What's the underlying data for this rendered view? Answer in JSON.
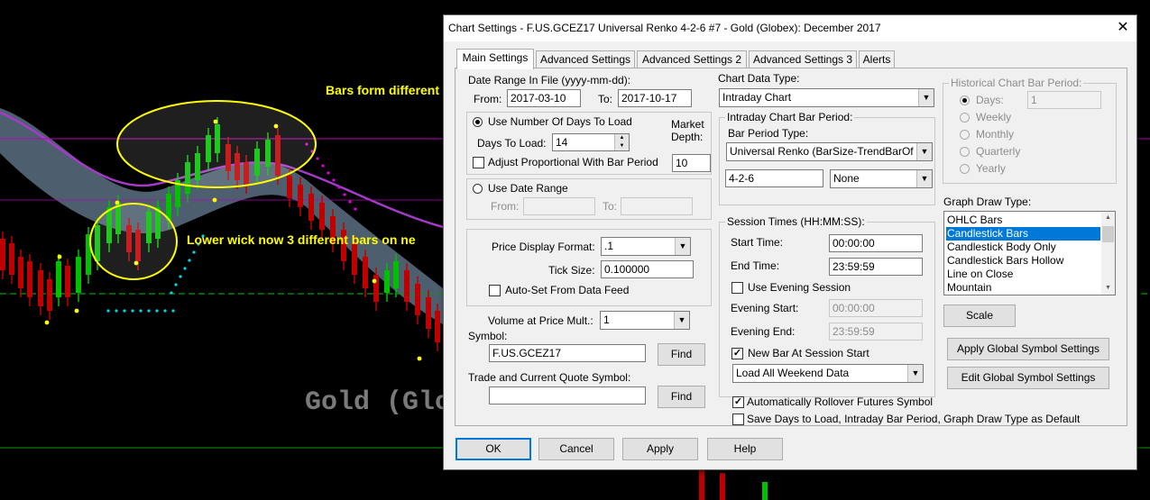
{
  "background_chart": {
    "annotation_top": "Bars form different",
    "annotation_mid": "Lower wick now 3 different bars on ne",
    "watermark": "Gold (Glo",
    "colors": {
      "up": "#00c000",
      "down": "#c00000",
      "ribbon": "#5a6f82",
      "ma": "#a33bc7",
      "magenta_line": "#c000c0",
      "green_dash": "#00a000",
      "cyan_dots": "#00d8e8",
      "pink_dots": "#e000e0"
    }
  },
  "dialog": {
    "title": "Chart Settings - F.US.GCEZ17  Universal Renko 4-2-6  #7 - Gold (Globex): December 2017",
    "close_glyph": "✕",
    "tabs": [
      "Main Settings",
      "Advanced Settings",
      "Advanced Settings 2",
      "Advanced Settings 3",
      "Alerts"
    ],
    "date_range": {
      "label": "Date Range In File (yyyy-mm-dd):",
      "from_label": "From:",
      "from_value": "2017-03-10",
      "to_label": "To:",
      "to_value": "2017-10-17"
    },
    "days_group": {
      "use_days_label": "Use Number Of Days To Load",
      "days_label": "Days To Load:",
      "days_value": "14",
      "market_depth_label_1": "Market",
      "market_depth_label_2": "Depth:",
      "market_depth_value": "10",
      "adjust_label": "Adjust Proportional With Bar Period"
    },
    "date_range_group": {
      "use_date_range_label": "Use Date Range",
      "from_label": "From:",
      "to_label": "To:"
    },
    "price_group": {
      "price_format_label": "Price Display Format:",
      "price_format_value": ".1",
      "tick_size_label": "Tick Size:",
      "tick_size_value": "0.100000",
      "autoset_label": "Auto-Set From Data Feed"
    },
    "volume_label": "Volume at Price Mult.:",
    "volume_value": "1",
    "symbol_label": "Symbol:",
    "symbol_value": "F.US.GCEZ17",
    "find_label": "Find",
    "trade_symbol_label": "Trade and Current Quote Symbol:",
    "trade_symbol_value": "",
    "find2_label": "Find",
    "chart_data_type_label": "Chart Data Type:",
    "chart_data_type_value": "Intraday Chart",
    "intraday_group": {
      "title": "Intraday Chart Bar Period:",
      "bar_period_type_label": "Bar Period Type:",
      "bar_period_type_value": "Universal Renko (BarSize-TrendBarOf",
      "bar_value": "4-2-6",
      "none_value": "None"
    },
    "session_group": {
      "title": "Session Times (HH:MM:SS):",
      "start_label": "Start Time:",
      "start_value": "00:00:00",
      "end_label": "End Time:",
      "end_value": "23:59:59",
      "evening_label": "Use Evening Session",
      "evening_start_label": "Evening Start:",
      "evening_start_value": "00:00:00",
      "evening_end_label": "Evening End:",
      "evening_end_value": "23:59:59",
      "new_bar_label": "New Bar At Session Start",
      "weekend_value": "Load All Weekend Data"
    },
    "auto_rollover_label": "Automatically Rollover Futures Symbol",
    "save_default_label": "Save Days to Load, Intraday Bar Period, Graph Draw Type as Default",
    "historical_group": {
      "title": "Historical Chart Bar Period:",
      "options": [
        "Days:",
        "Weekly",
        "Monthly",
        "Quarterly",
        "Yearly"
      ],
      "days_value": "1"
    },
    "graph_draw_label": "Graph Draw Type:",
    "graph_draw_items": [
      "OHLC Bars",
      "Candlestick Bars",
      "Candlestick Body Only",
      "Candlestick Bars Hollow",
      "Line on Close",
      "Mountain"
    ],
    "graph_draw_selected": 1,
    "scale_label": "Scale",
    "apply_global_label": "Apply Global Symbol Settings",
    "edit_global_label": "Edit Global Symbol Settings",
    "ok_label": "OK",
    "cancel_label": "Cancel",
    "apply_label": "Apply",
    "help_label": "Help"
  }
}
